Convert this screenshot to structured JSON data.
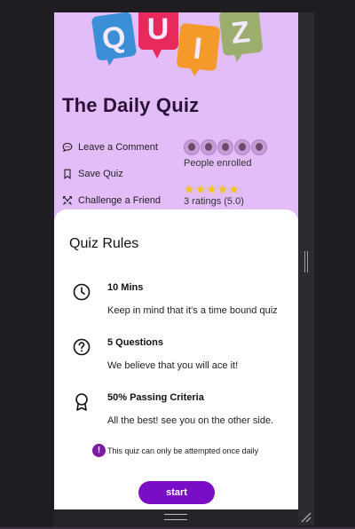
{
  "header": {
    "logo_letters": [
      "Q",
      "U",
      "I",
      "Z"
    ],
    "logo_colors": [
      "#3a8fd6",
      "#e8295b",
      "#f39a2a",
      "#9bae6e"
    ],
    "title": "The Daily Quiz"
  },
  "actions": [
    {
      "label": "Leave a Comment",
      "icon": "comment-icon"
    },
    {
      "label": "Save Quiz",
      "icon": "bookmark-icon"
    },
    {
      "label": "Challenge a Friend",
      "icon": "challenge-icon"
    }
  ],
  "enrollment": {
    "avatar_count": 5,
    "label": "People enrolled"
  },
  "rating": {
    "stars": 5,
    "max": 5,
    "label": "3 ratings (5.0)"
  },
  "rules": {
    "title": "Quiz Rules",
    "items": [
      {
        "heading": "10 Mins",
        "description": "Keep in mind that it's a time bound quiz",
        "icon": "clock-icon"
      },
      {
        "heading": "5 Questions",
        "description": "We believe that you will ace it!",
        "icon": "question-icon"
      },
      {
        "heading": "50% Passing Criteria",
        "description": "All the best! see you on the other side.",
        "icon": "award-icon"
      }
    ],
    "notice_symbol": "!",
    "notice": "This quiz can only be attempted once daily",
    "start_label": "start"
  },
  "colors": {
    "header_bg": "#e2bdf7",
    "accent": "#7a0ec6",
    "star": "#f0c419"
  }
}
